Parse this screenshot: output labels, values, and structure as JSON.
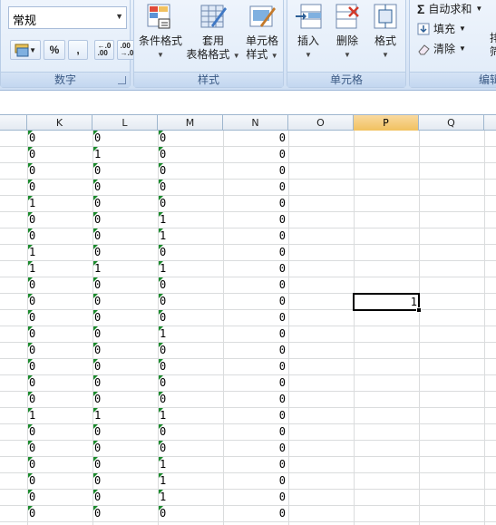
{
  "ribbon": {
    "number_group": {
      "format_value": "常规",
      "buttons": [
        "%",
        ","
      ],
      "inc_decimal": "+.0 .00",
      "dec_decimal": ".00 →.0",
      "title": "数字"
    },
    "styles_group": {
      "conditional_format": "条件格式",
      "table_format_1": "套用",
      "table_format_2": "表格格式",
      "cell_style_1": "单元格",
      "cell_style_2": "样式",
      "title": "样式"
    },
    "cells_group": {
      "insert": "插入",
      "delete": "删除",
      "format": "格式",
      "title": "单元格"
    },
    "editing_group": {
      "autosum": "自动求和",
      "fill": "填充",
      "clear": "清除",
      "sort_partial": "排",
      "find_partial": "筛",
      "title": "编辑"
    }
  },
  "columns": [
    "K",
    "L",
    "M",
    "N",
    "O",
    "P",
    "Q"
  ],
  "active_column": "P",
  "rows": [
    {
      "K": "0",
      "L": "0",
      "M": "0",
      "N": "0"
    },
    {
      "K": "0",
      "L": "1",
      "M": "0",
      "N": "0"
    },
    {
      "K": "0",
      "L": "0",
      "M": "0",
      "N": "0"
    },
    {
      "K": "0",
      "L": "0",
      "M": "0",
      "N": "0"
    },
    {
      "K": "1",
      "L": "0",
      "M": "0",
      "N": "0"
    },
    {
      "K": "0",
      "L": "0",
      "M": "1",
      "N": "0"
    },
    {
      "K": "0",
      "L": "0",
      "M": "1",
      "N": "0"
    },
    {
      "K": "1",
      "L": "0",
      "M": "0",
      "N": "0"
    },
    {
      "K": "1",
      "L": "1",
      "M": "1",
      "N": "0"
    },
    {
      "K": "0",
      "L": "0",
      "M": "0",
      "N": "0"
    },
    {
      "K": "0",
      "L": "0",
      "M": "0",
      "N": "0",
      "P": "1"
    },
    {
      "K": "0",
      "L": "0",
      "M": "0",
      "N": "0"
    },
    {
      "K": "0",
      "L": "0",
      "M": "1",
      "N": "0"
    },
    {
      "K": "0",
      "L": "0",
      "M": "0",
      "N": "0"
    },
    {
      "K": "0",
      "L": "0",
      "M": "0",
      "N": "0"
    },
    {
      "K": "0",
      "L": "0",
      "M": "0",
      "N": "0"
    },
    {
      "K": "0",
      "L": "0",
      "M": "0",
      "N": "0"
    },
    {
      "K": "1",
      "L": "1",
      "M": "1",
      "N": "0"
    },
    {
      "K": "0",
      "L": "0",
      "M": "0",
      "N": "0"
    },
    {
      "K": "0",
      "L": "0",
      "M": "0",
      "N": "0"
    },
    {
      "K": "0",
      "L": "0",
      "M": "1",
      "N": "0"
    },
    {
      "K": "0",
      "L": "0",
      "M": "1",
      "N": "0"
    },
    {
      "K": "0",
      "L": "0",
      "M": "1",
      "N": "0"
    },
    {
      "K": "0",
      "L": "0",
      "M": "0",
      "N": "0"
    }
  ],
  "selected_cell": {
    "column": "P",
    "row_index": 10,
    "value": "1"
  },
  "colors": {
    "ribbon_bg": "#dbe7f7",
    "active_column": "#f1c15f",
    "error_triangle": "#1b8a2c",
    "gridline": "#dadcdd"
  }
}
